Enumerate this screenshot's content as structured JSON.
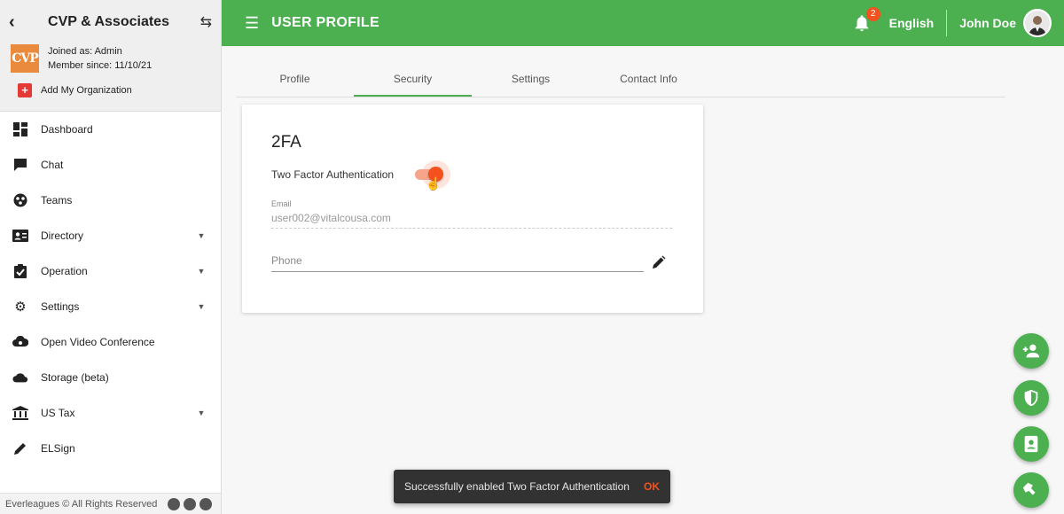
{
  "sidebar": {
    "org_name": "CVP & Associates",
    "logo_text": "CVP",
    "joined": "Joined as: Admin",
    "member_since": "Member since: 11/10/21",
    "add_org": "Add My Organization",
    "items": [
      {
        "label": "Dashboard",
        "icon": "dashboard-icon",
        "dropdown": false
      },
      {
        "label": "Chat",
        "icon": "chat-icon",
        "dropdown": false
      },
      {
        "label": "Teams",
        "icon": "teams-icon",
        "dropdown": false
      },
      {
        "label": "Directory",
        "icon": "directory-icon",
        "dropdown": true
      },
      {
        "label": "Operation",
        "icon": "operation-icon",
        "dropdown": true
      },
      {
        "label": "Settings",
        "icon": "settings-icon",
        "dropdown": true
      },
      {
        "label": "Open Video Conference",
        "icon": "video-conference-icon",
        "dropdown": false
      },
      {
        "label": "Storage (beta)",
        "icon": "cloud-icon",
        "dropdown": false
      },
      {
        "label": "US Tax",
        "icon": "bank-icon",
        "dropdown": true
      },
      {
        "label": "ELSign",
        "icon": "pen-icon",
        "dropdown": false
      }
    ],
    "footer": "Everleagues © All Rights Reserved"
  },
  "header": {
    "title": "USER PROFILE",
    "notification_count": "2",
    "language": "English",
    "user_name": "John Doe"
  },
  "tabs": [
    {
      "label": "Profile",
      "active": false
    },
    {
      "label": "Security",
      "active": true
    },
    {
      "label": "Settings",
      "active": false
    },
    {
      "label": "Contact Info",
      "active": false
    }
  ],
  "security_card": {
    "title": "2FA",
    "two_factor_label": "Two Factor Authentication",
    "two_factor_enabled": true,
    "email_label": "Email",
    "email_value": "user002@vitalcousa.com",
    "phone_placeholder": "Phone"
  },
  "fabs": [
    "add-user-icon",
    "shield-icon",
    "contact-card-icon",
    "pin-icon"
  ],
  "snackbar": {
    "message": "Successfully enabled Two Factor Authentication",
    "action": "OK"
  },
  "colors": {
    "primary": "#4caf50",
    "accent": "#f4511e",
    "snackbar_bg": "#323232"
  }
}
